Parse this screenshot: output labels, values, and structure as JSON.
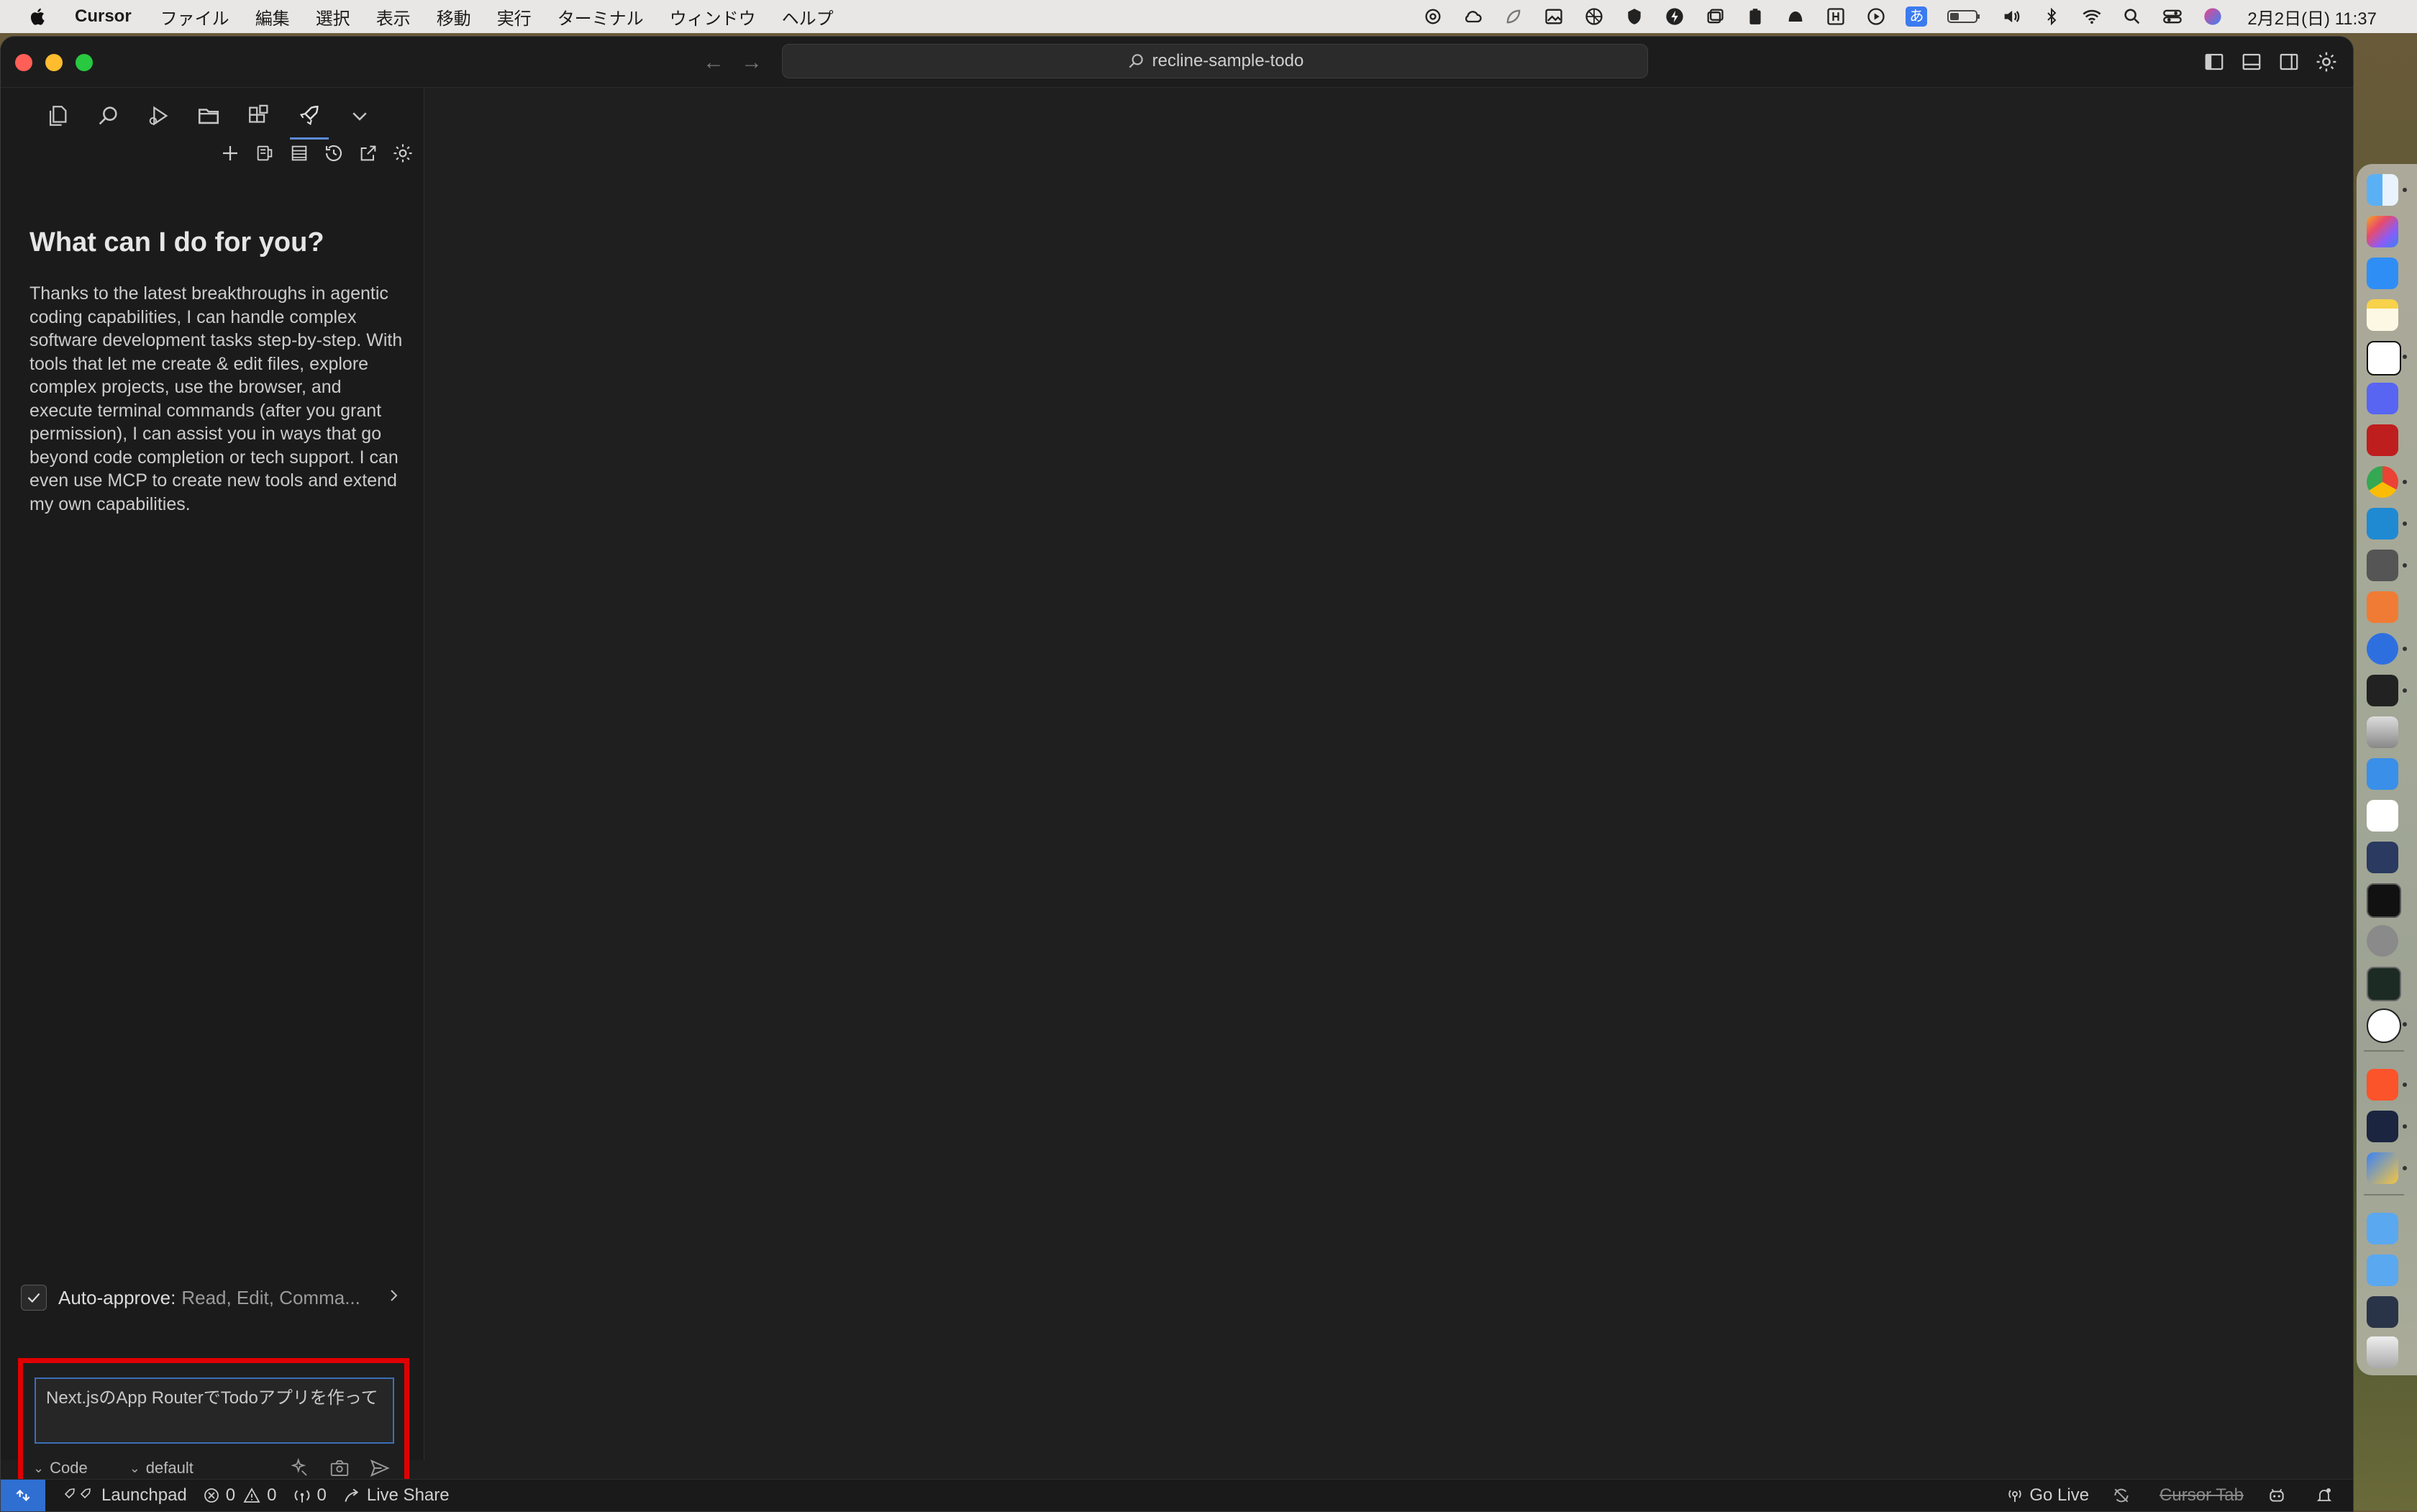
{
  "menubar": {
    "app_name": "Cursor",
    "menus": [
      "ファイル",
      "編集",
      "選択",
      "表示",
      "移動",
      "実行",
      "ターミナル",
      "ウィンドウ",
      "ヘルプ"
    ],
    "clock": "2月2日(日) 11:37",
    "status_icons": [
      "chatgpt-icon",
      "cloud-sync-icon",
      "leaf-icon",
      "image-icon",
      "grid-icon",
      "shield-icon",
      "bolt-icon",
      "window-stack-icon",
      "clipboard-icon",
      "hat-icon",
      "h-box-icon",
      "play-icon",
      "input-method-icon",
      "battery-icon",
      "volume-icon",
      "bluetooth-icon",
      "wifi-icon",
      "search-icon",
      "control-center-icon",
      "siri-icon"
    ],
    "input_method_label": "あ"
  },
  "window": {
    "command_center": "recline-sample-todo"
  },
  "sidebar": {
    "activity_icons": [
      "explorer-icon",
      "search-icon",
      "run-debug-icon",
      "folder-icon",
      "extensions-icon",
      "launchpad-rocket-icon",
      "more-chevron-icon"
    ],
    "panel_tools": [
      "new-task-icon",
      "mcp-servers-icon",
      "account-icon",
      "history-icon",
      "popout-icon",
      "settings-icon"
    ],
    "welcome_title": "What can I do for you?",
    "welcome_text": "Thanks to the latest breakthroughs in agentic coding capabilities, I can handle complex software development tasks step-by-step. With tools that let me create & edit files, explore complex projects, use the browser, and execute terminal commands (after you grant permission), I can assist you in ways that go beyond code completion or tech support. I can even use MCP to create new tools and extend my own capabilities.",
    "auto_approve": {
      "label": "Auto-approve:",
      "value": "Read, Edit, Comma...",
      "checked": true
    },
    "chat_input": {
      "value": "Next.jsのApp RouterでTodoアプリを作って",
      "mode": "Code",
      "profile": "default"
    }
  },
  "statusbar": {
    "launchpad": "Launchpad",
    "errors": "0",
    "warnings": "0",
    "ports": "0",
    "live_share": "Live Share",
    "go_live": "Go Live",
    "cursor_tab": "Cursor Tab"
  },
  "colors": {
    "accent": "#2f6fd2",
    "highlight_border": "#e00000",
    "input_focus": "#3b6fb8"
  },
  "dock": {
    "apps": [
      "finder",
      "launchpad",
      "app-store",
      "notes",
      "notion",
      "discord",
      "filezilla",
      "chrome",
      "vscode",
      "tableplus",
      "sketch",
      "maps-pin",
      "cube-app",
      "database",
      "xcode",
      "app-store-2",
      "simulator",
      "terminal",
      "settings",
      "activity-monitor",
      "chatgpt",
      "brave",
      "cursor",
      "reeder",
      "folder-docs",
      "folder-apps",
      "screenshot",
      "trash"
    ]
  }
}
